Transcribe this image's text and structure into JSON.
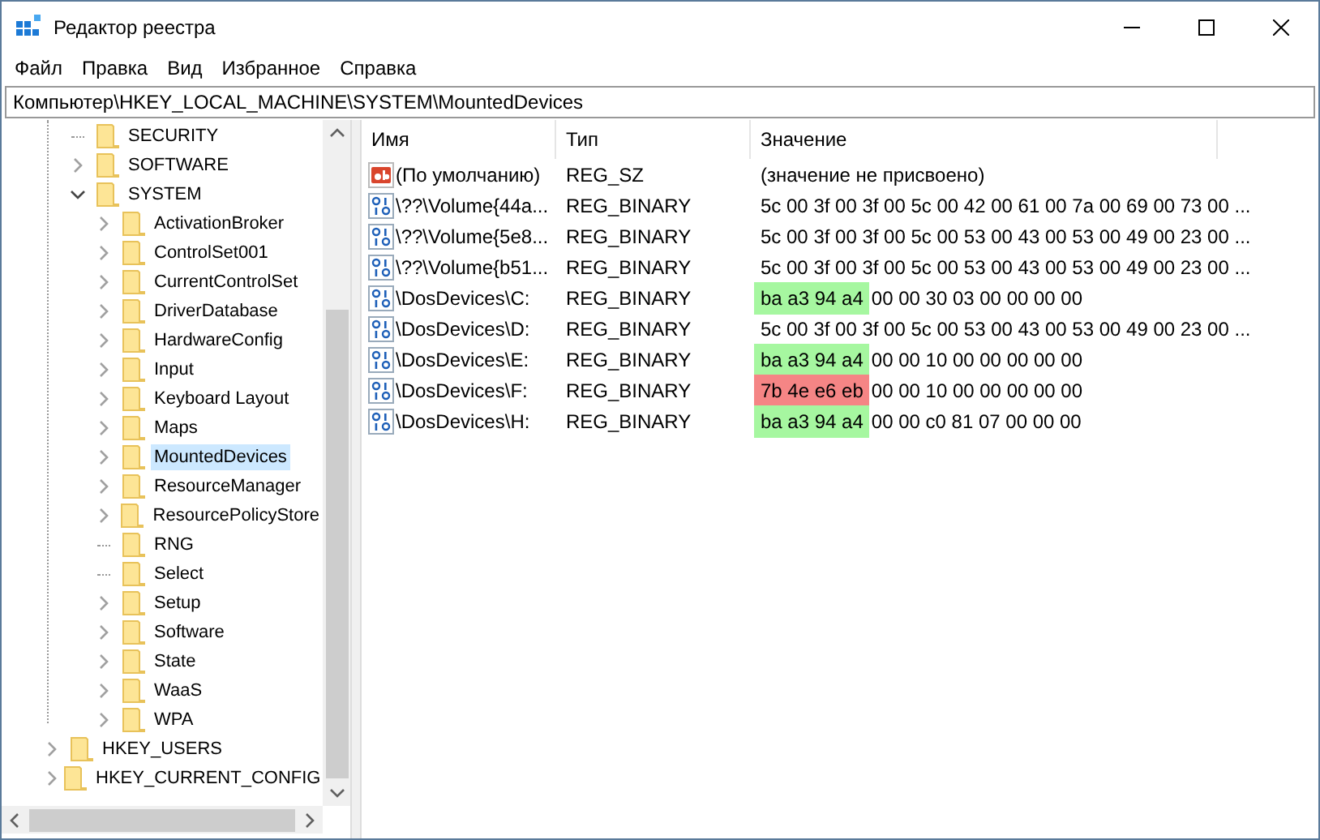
{
  "window": {
    "title": "Редактор реестра"
  },
  "menu": [
    "Файл",
    "Правка",
    "Вид",
    "Избранное",
    "Справка"
  ],
  "address": "Компьютер\\HKEY_LOCAL_MACHINE\\SYSTEM\\MountedDevices",
  "tree": {
    "hklm_children": [
      {
        "label": "SECURITY",
        "expandable": false,
        "selected": false
      },
      {
        "label": "SOFTWARE",
        "expandable": true,
        "expanded": false,
        "selected": false
      },
      {
        "label": "SYSTEM",
        "expandable": true,
        "expanded": true,
        "selected": false,
        "children": [
          {
            "label": "ActivationBroker",
            "expandable": true,
            "expanded": false,
            "selected": false
          },
          {
            "label": "ControlSet001",
            "expandable": true,
            "expanded": false,
            "selected": false
          },
          {
            "label": "CurrentControlSet",
            "expandable": true,
            "expanded": false,
            "selected": false
          },
          {
            "label": "DriverDatabase",
            "expandable": true,
            "expanded": false,
            "selected": false
          },
          {
            "label": "HardwareConfig",
            "expandable": true,
            "expanded": false,
            "selected": false
          },
          {
            "label": "Input",
            "expandable": true,
            "expanded": false,
            "selected": false
          },
          {
            "label": "Keyboard Layout",
            "expandable": true,
            "expanded": false,
            "selected": false
          },
          {
            "label": "Maps",
            "expandable": true,
            "expanded": false,
            "selected": false
          },
          {
            "label": "MountedDevices",
            "expandable": true,
            "expanded": false,
            "selected": true
          },
          {
            "label": "ResourceManager",
            "expandable": true,
            "expanded": false,
            "selected": false
          },
          {
            "label": "ResourcePolicyStore",
            "expandable": true,
            "expanded": false,
            "selected": false
          },
          {
            "label": "RNG",
            "expandable": false,
            "selected": false
          },
          {
            "label": "Select",
            "expandable": false,
            "selected": false
          },
          {
            "label": "Setup",
            "expandable": true,
            "expanded": false,
            "selected": false
          },
          {
            "label": "Software",
            "expandable": true,
            "expanded": false,
            "selected": false
          },
          {
            "label": "State",
            "expandable": true,
            "expanded": false,
            "selected": false
          },
          {
            "label": "WaaS",
            "expandable": true,
            "expanded": false,
            "selected": false
          },
          {
            "label": "WPA",
            "expandable": true,
            "expanded": false,
            "selected": false
          }
        ]
      }
    ],
    "root_keys": [
      {
        "label": "HKEY_USERS",
        "expandable": true,
        "expanded": false,
        "selected": false
      },
      {
        "label": "HKEY_CURRENT_CONFIG",
        "expandable": true,
        "expanded": false,
        "selected": false
      }
    ]
  },
  "table": {
    "columns": [
      "Имя",
      "Тип",
      "Значение"
    ],
    "rows": [
      {
        "kind": "string",
        "name": "(По умолчанию)",
        "type": "REG_SZ",
        "value": "(значение не присвоено)"
      },
      {
        "kind": "binary",
        "name": "\\??\\Volume{44a...",
        "type": "REG_BINARY",
        "value": "5c 00 3f 00 3f 00 5c 00 42 00 61 00 7a 00 69 00 73 00 ..."
      },
      {
        "kind": "binary",
        "name": "\\??\\Volume{5e8...",
        "type": "REG_BINARY",
        "value": "5c 00 3f 00 3f 00 5c 00 53 00 43 00 53 00 49 00 23 00 ..."
      },
      {
        "kind": "binary",
        "name": "\\??\\Volume{b51...",
        "type": "REG_BINARY",
        "value": "5c 00 3f 00 3f 00 5c 00 53 00 43 00 53 00 49 00 23 00 ..."
      },
      {
        "kind": "binary",
        "name": "\\DosDevices\\C:",
        "type": "REG_BINARY",
        "highlight": {
          "text": "ba a3 94 a4",
          "color": "#a6f7a0"
        },
        "value": "00 00 30 03 00 00 00 00"
      },
      {
        "kind": "binary",
        "name": "\\DosDevices\\D:",
        "type": "REG_BINARY",
        "value": "5c 00 3f 00 3f 00 5c 00 53 00 43 00 53 00 49 00 23 00 ..."
      },
      {
        "kind": "binary",
        "name": "\\DosDevices\\E:",
        "type": "REG_BINARY",
        "highlight": {
          "text": "ba a3 94 a4",
          "color": "#a6f7a0"
        },
        "value": "00 00 10 00 00 00 00 00"
      },
      {
        "kind": "binary",
        "name": "\\DosDevices\\F:",
        "type": "REG_BINARY",
        "highlight": {
          "text": "7b 4e e6 eb",
          "color": "#f58585"
        },
        "value": "00 00 10 00 00 00 00 00"
      },
      {
        "kind": "binary",
        "name": "\\DosDevices\\H:",
        "type": "REG_BINARY",
        "highlight": {
          "text": "ba a3 94 a4",
          "color": "#a6f7a0"
        },
        "value": "00 00 c0 81 07 00 00 00"
      }
    ]
  }
}
